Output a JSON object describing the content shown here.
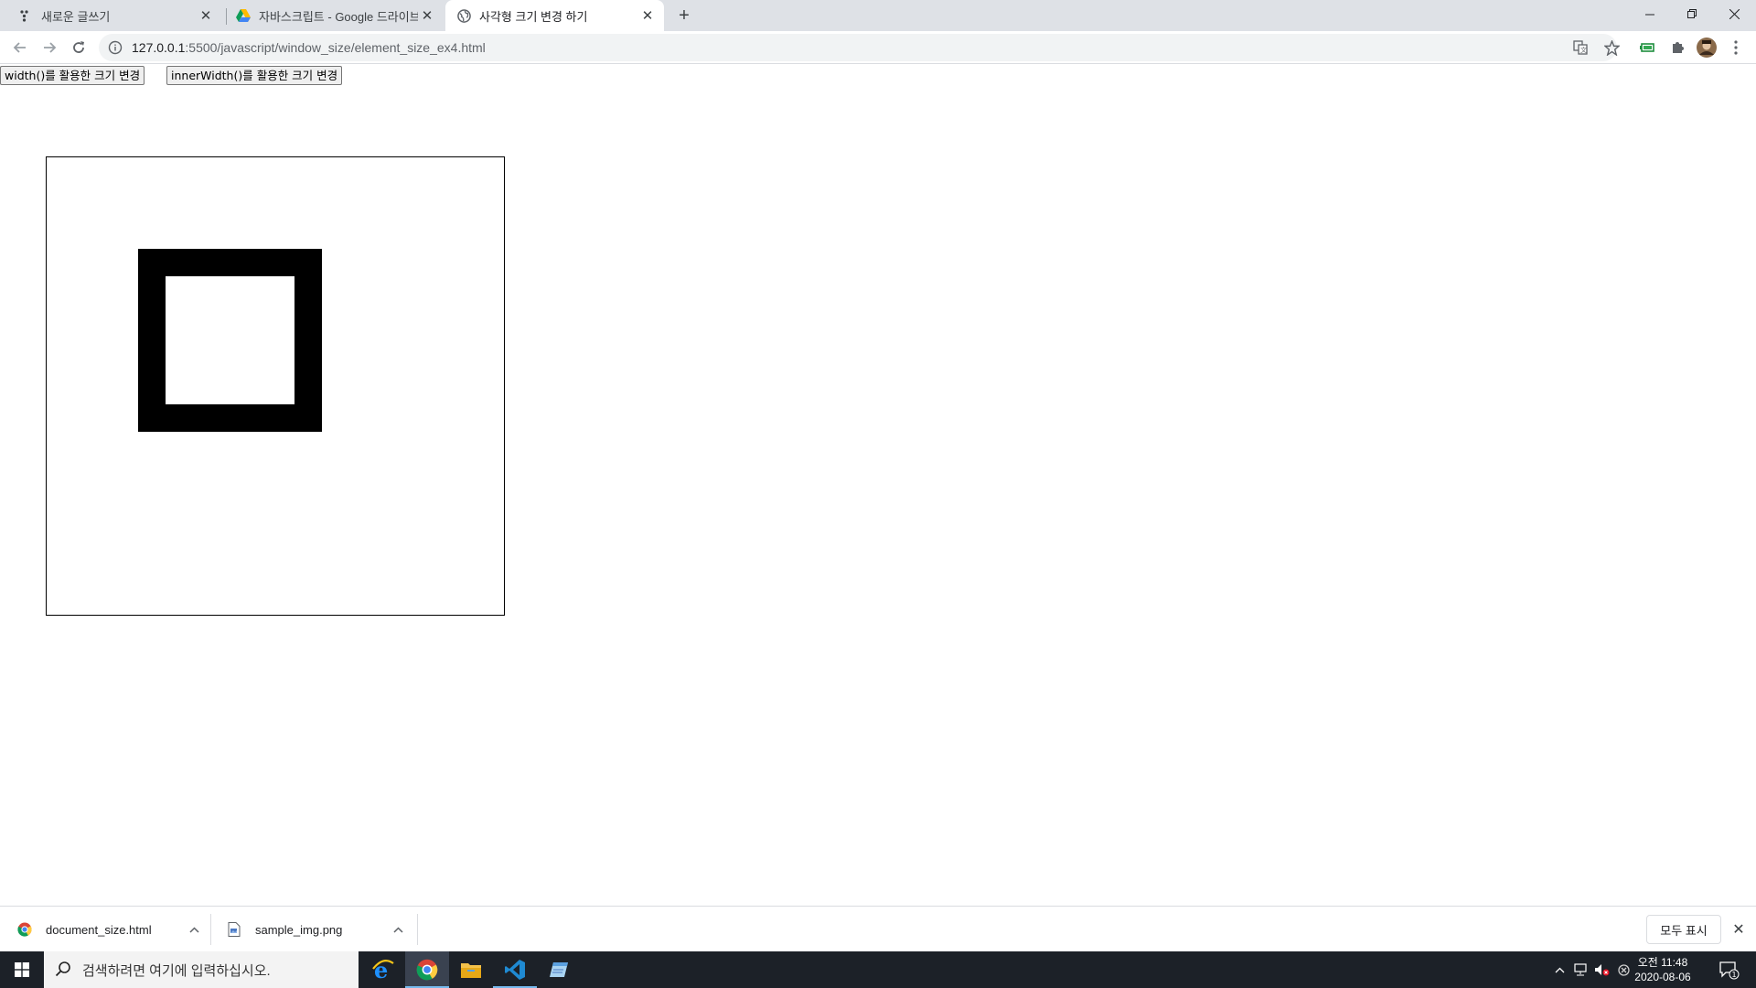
{
  "browser": {
    "tabs": [
      {
        "title": "새로운 글쓰기"
      },
      {
        "title": "자바스크립트 - Google 드라이브"
      },
      {
        "title": "사각형 크기 변경 하기"
      }
    ],
    "active_tab": 2,
    "url_host": "127.0.0.1",
    "url_rest": ":5500/javascript/window_size/element_size_ex4.html"
  },
  "page": {
    "buttons": [
      {
        "label": "width()를 활용한 크기 변경"
      },
      {
        "label": "innerWidth()를 활용한 크기 변경"
      }
    ]
  },
  "downloads": {
    "items": [
      {
        "name": "document_size.html",
        "icon": "chrome-file-icon"
      },
      {
        "name": "sample_img.png",
        "icon": "image-file-icon"
      }
    ],
    "show_all_label": "모두 표시"
  },
  "taskbar": {
    "search_placeholder": "검색하려면 여기에 입력하십시오.",
    "clock_time": "오전 11:48",
    "clock_date": "2020-08-06",
    "notification_count": "1"
  },
  "colors": {
    "tabstrip": "#dee1e6",
    "taskbar": "#1c2128",
    "box_border": "#000000"
  }
}
